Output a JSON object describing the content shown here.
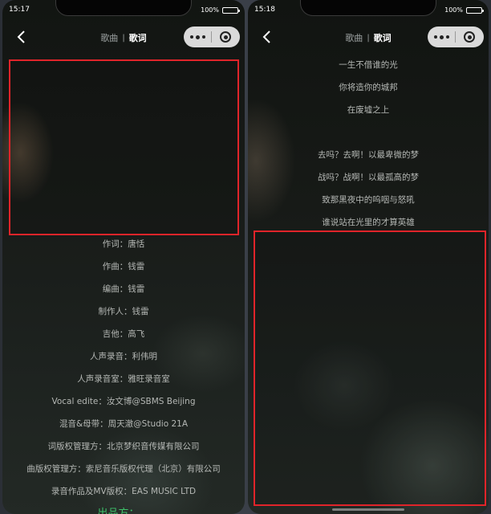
{
  "left": {
    "status": {
      "time": "15:17",
      "battery": "100%"
    },
    "nav": {
      "tab_song": "歌曲",
      "separator": "|",
      "tab_lyrics": "歌词"
    },
    "lyrics": [
      "作词：唐恬",
      "作曲：钱雷",
      "编曲：钱雷",
      "制作人：钱雷",
      "吉他：高飞",
      "人声录音：利伟明",
      "人声录音室：雅旺录音室",
      "Vocal edite：汝文博@SBMS Beijing",
      "混音&母带：周天澈@Studio 21A",
      "词版权管理方：北京梦织音传媒有限公司",
      "曲版权管理方：索尼音乐版权代理（北京）有限公司",
      "录音作品及MV版权：EAS MUSIC LTD"
    ],
    "current_line": "出品方：…"
  },
  "right": {
    "status": {
      "time": "15:18",
      "battery": "100%"
    },
    "nav": {
      "tab_song": "歌曲",
      "separator": "|",
      "tab_lyrics": "歌词"
    },
    "lyrics_top": [
      "一生不借谁的光",
      "你将造你的城邦",
      "在废墟之上"
    ],
    "lyrics_bottom": [
      "去吗？去啊！以最卑微的梦",
      "战吗？战啊！以最孤高的梦",
      "致那黑夜中的呜咽与怒吼",
      "谁说站在光里的才算英雄"
    ]
  },
  "colors": {
    "highlight": "#e0242a",
    "current_lyric": "#3ec36b"
  }
}
